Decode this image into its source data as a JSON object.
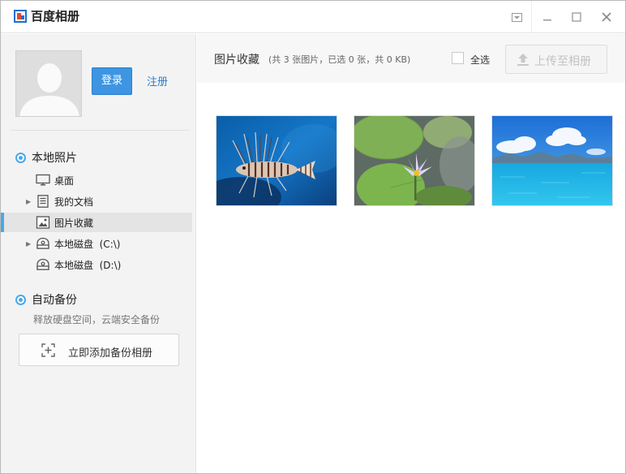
{
  "app": {
    "title": "百度相册"
  },
  "titlebar": {
    "menu_icon": "dropdown-menu-icon",
    "minimize_icon": "minimize-icon",
    "maximize_icon": "maximize-icon",
    "close_icon": "close-icon"
  },
  "user": {
    "login_label": "登录",
    "register_label": "注册"
  },
  "local_photos": {
    "title": "本地照片",
    "items": [
      {
        "label": "桌面",
        "icon": "desktop-icon",
        "expandable": false,
        "active": false
      },
      {
        "label": "我的文档",
        "icon": "document-icon",
        "expandable": true,
        "active": false
      },
      {
        "label": "图片收藏",
        "icon": "picture-icon",
        "expandable": false,
        "active": true
      },
      {
        "label": "本地磁盘  (C:\\)",
        "icon": "disk-icon",
        "expandable": true,
        "active": false
      },
      {
        "label": "本地磁盘  (D:\\)",
        "icon": "disk-icon",
        "expandable": false,
        "active": false
      }
    ]
  },
  "auto_backup": {
    "title": "自动备份",
    "subtitle": "释放硬盘空间，云端安全备份",
    "button_label": "立即添加备份相册"
  },
  "main": {
    "title": "图片收藏",
    "stats": "(共 3 张图片，已选 0 张，共 0 KB)",
    "select_all_label": "全选",
    "upload_label": "上传至相册",
    "photos": [
      {
        "subject": "lionfish"
      },
      {
        "subject": "water-lily"
      },
      {
        "subject": "sea-and-sky"
      }
    ]
  },
  "colors": {
    "accent": "#3d95e3",
    "link": "#2f7dcc",
    "sidebar_bg": "#f3f3f3",
    "active_marker": "#4aa8e8"
  }
}
